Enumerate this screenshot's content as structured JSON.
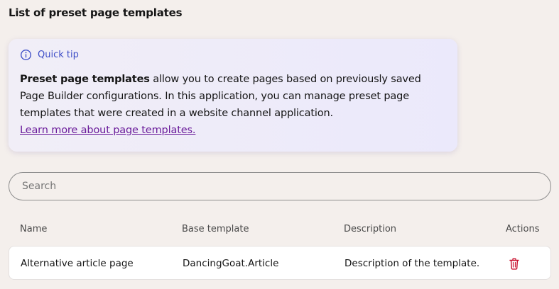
{
  "page": {
    "title": "List of preset page templates"
  },
  "tip": {
    "heading": "Quick tip",
    "bold_lead": "Preset page templates",
    "text": " allow you to create pages based on previously saved Page Builder configurations. In this application, you can manage preset page templates that were created in a website channel application.",
    "link": "Learn more about page templates."
  },
  "search": {
    "placeholder": "Search",
    "value": ""
  },
  "table": {
    "columns": [
      "Name",
      "Base template",
      "Description",
      "Actions"
    ],
    "rows": [
      {
        "name": "Alternative article page",
        "base_template": "DancingGoat.Article",
        "description": "Description of the template.",
        "action_icon": "trash-icon"
      }
    ]
  },
  "colors": {
    "accent": "#3e4ec7",
    "link": "#6a1b9a",
    "danger": "#c8102e"
  }
}
